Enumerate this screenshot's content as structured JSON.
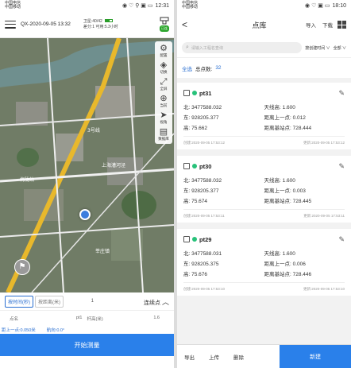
{
  "left": {
    "statusbar": {
      "carrier1": "中国电信",
      "carrier2": "中国移动",
      "time": "12:31",
      "icons": "◉ ♡ ⚲ ▣ ▭"
    },
    "topbar": {
      "title": "QX-2020-09-05 13:32",
      "satellites": "卫星:40/42",
      "mode": "差分:1",
      "remaining": "可用:5.3小时",
      "device_badge": "已连"
    },
    "tools": [
      {
        "label": "配置",
        "icon": "gear-icon"
      },
      {
        "label": "切换",
        "icon": "layers-icon"
      },
      {
        "label": "全屏",
        "icon": "fullscreen-icon"
      },
      {
        "label": "当前",
        "icon": "target-icon"
      },
      {
        "label": "视角",
        "icon": "navigate-icon"
      },
      {
        "label": "数据库",
        "icon": "database-icon"
      }
    ],
    "map_labels": [
      "3号线",
      "上海漕河泾",
      "莘庄镇",
      "梅陇站"
    ],
    "controls": {
      "by_time": "按时间(秒)",
      "by_distance": "按距离(米)",
      "interval": "1",
      "continuous": "连续点",
      "point_name_label": "点名",
      "point_name": "pt1",
      "pole_height_label": "杆高(米)",
      "pole_height": "1.6",
      "dist_prev": "距上一点:0.050米",
      "heading": "航向:0.0°",
      "start_button": "开始测量"
    }
  },
  "right": {
    "statusbar": {
      "carrier1": "中国电信",
      "carrier2": "中国移动",
      "time": "18:10",
      "icons": "◉ ♡ ▣ ▭"
    },
    "topbar": {
      "title": "点库",
      "import": "导入",
      "download": "下载"
    },
    "search": {
      "placeholder": "请输入工程名查询",
      "sort": "按创建时间 ∨",
      "filter": "全部 ∨"
    },
    "summary": {
      "select_all": "全选",
      "total_label": "总点数:",
      "total": "32"
    },
    "points": [
      {
        "name": "pt31",
        "north": "北: 3477588.032",
        "east": "东: 928205.377",
        "height": "高: 75.662",
        "antenna": "天线高: 1.600",
        "dist_prev": "距离上一点: 0.012",
        "dist_base": "距离基站点: 728.444",
        "created": "创建:2020-09-05 17:53:12",
        "updated": "更新:2020-09-05 17:53:12"
      },
      {
        "name": "pt30",
        "north": "北: 3477588.032",
        "east": "东: 928205.377",
        "height": "高: 75.674",
        "antenna": "天线高: 1.600",
        "dist_prev": "距离上一点: 0.003",
        "dist_base": "距离基站点: 728.445",
        "created": "创建:2020-09-05 17:53:11",
        "updated": "更新:2020-09-05 17:53:11"
      },
      {
        "name": "pt29",
        "north": "北: 3477588.031",
        "east": "东: 928205.375",
        "height": "高: 75.676",
        "antenna": "天线高: 1.600",
        "dist_prev": "距离上一点: 0.006",
        "dist_base": "距离基站点: 728.446",
        "created": "创建:2020-09-05 17:53:10",
        "updated": "更新:2020-09-05 17:53:10"
      }
    ],
    "bottom": {
      "export": "导出",
      "upload": "上传",
      "delete": "删除",
      "new": "新建"
    }
  }
}
